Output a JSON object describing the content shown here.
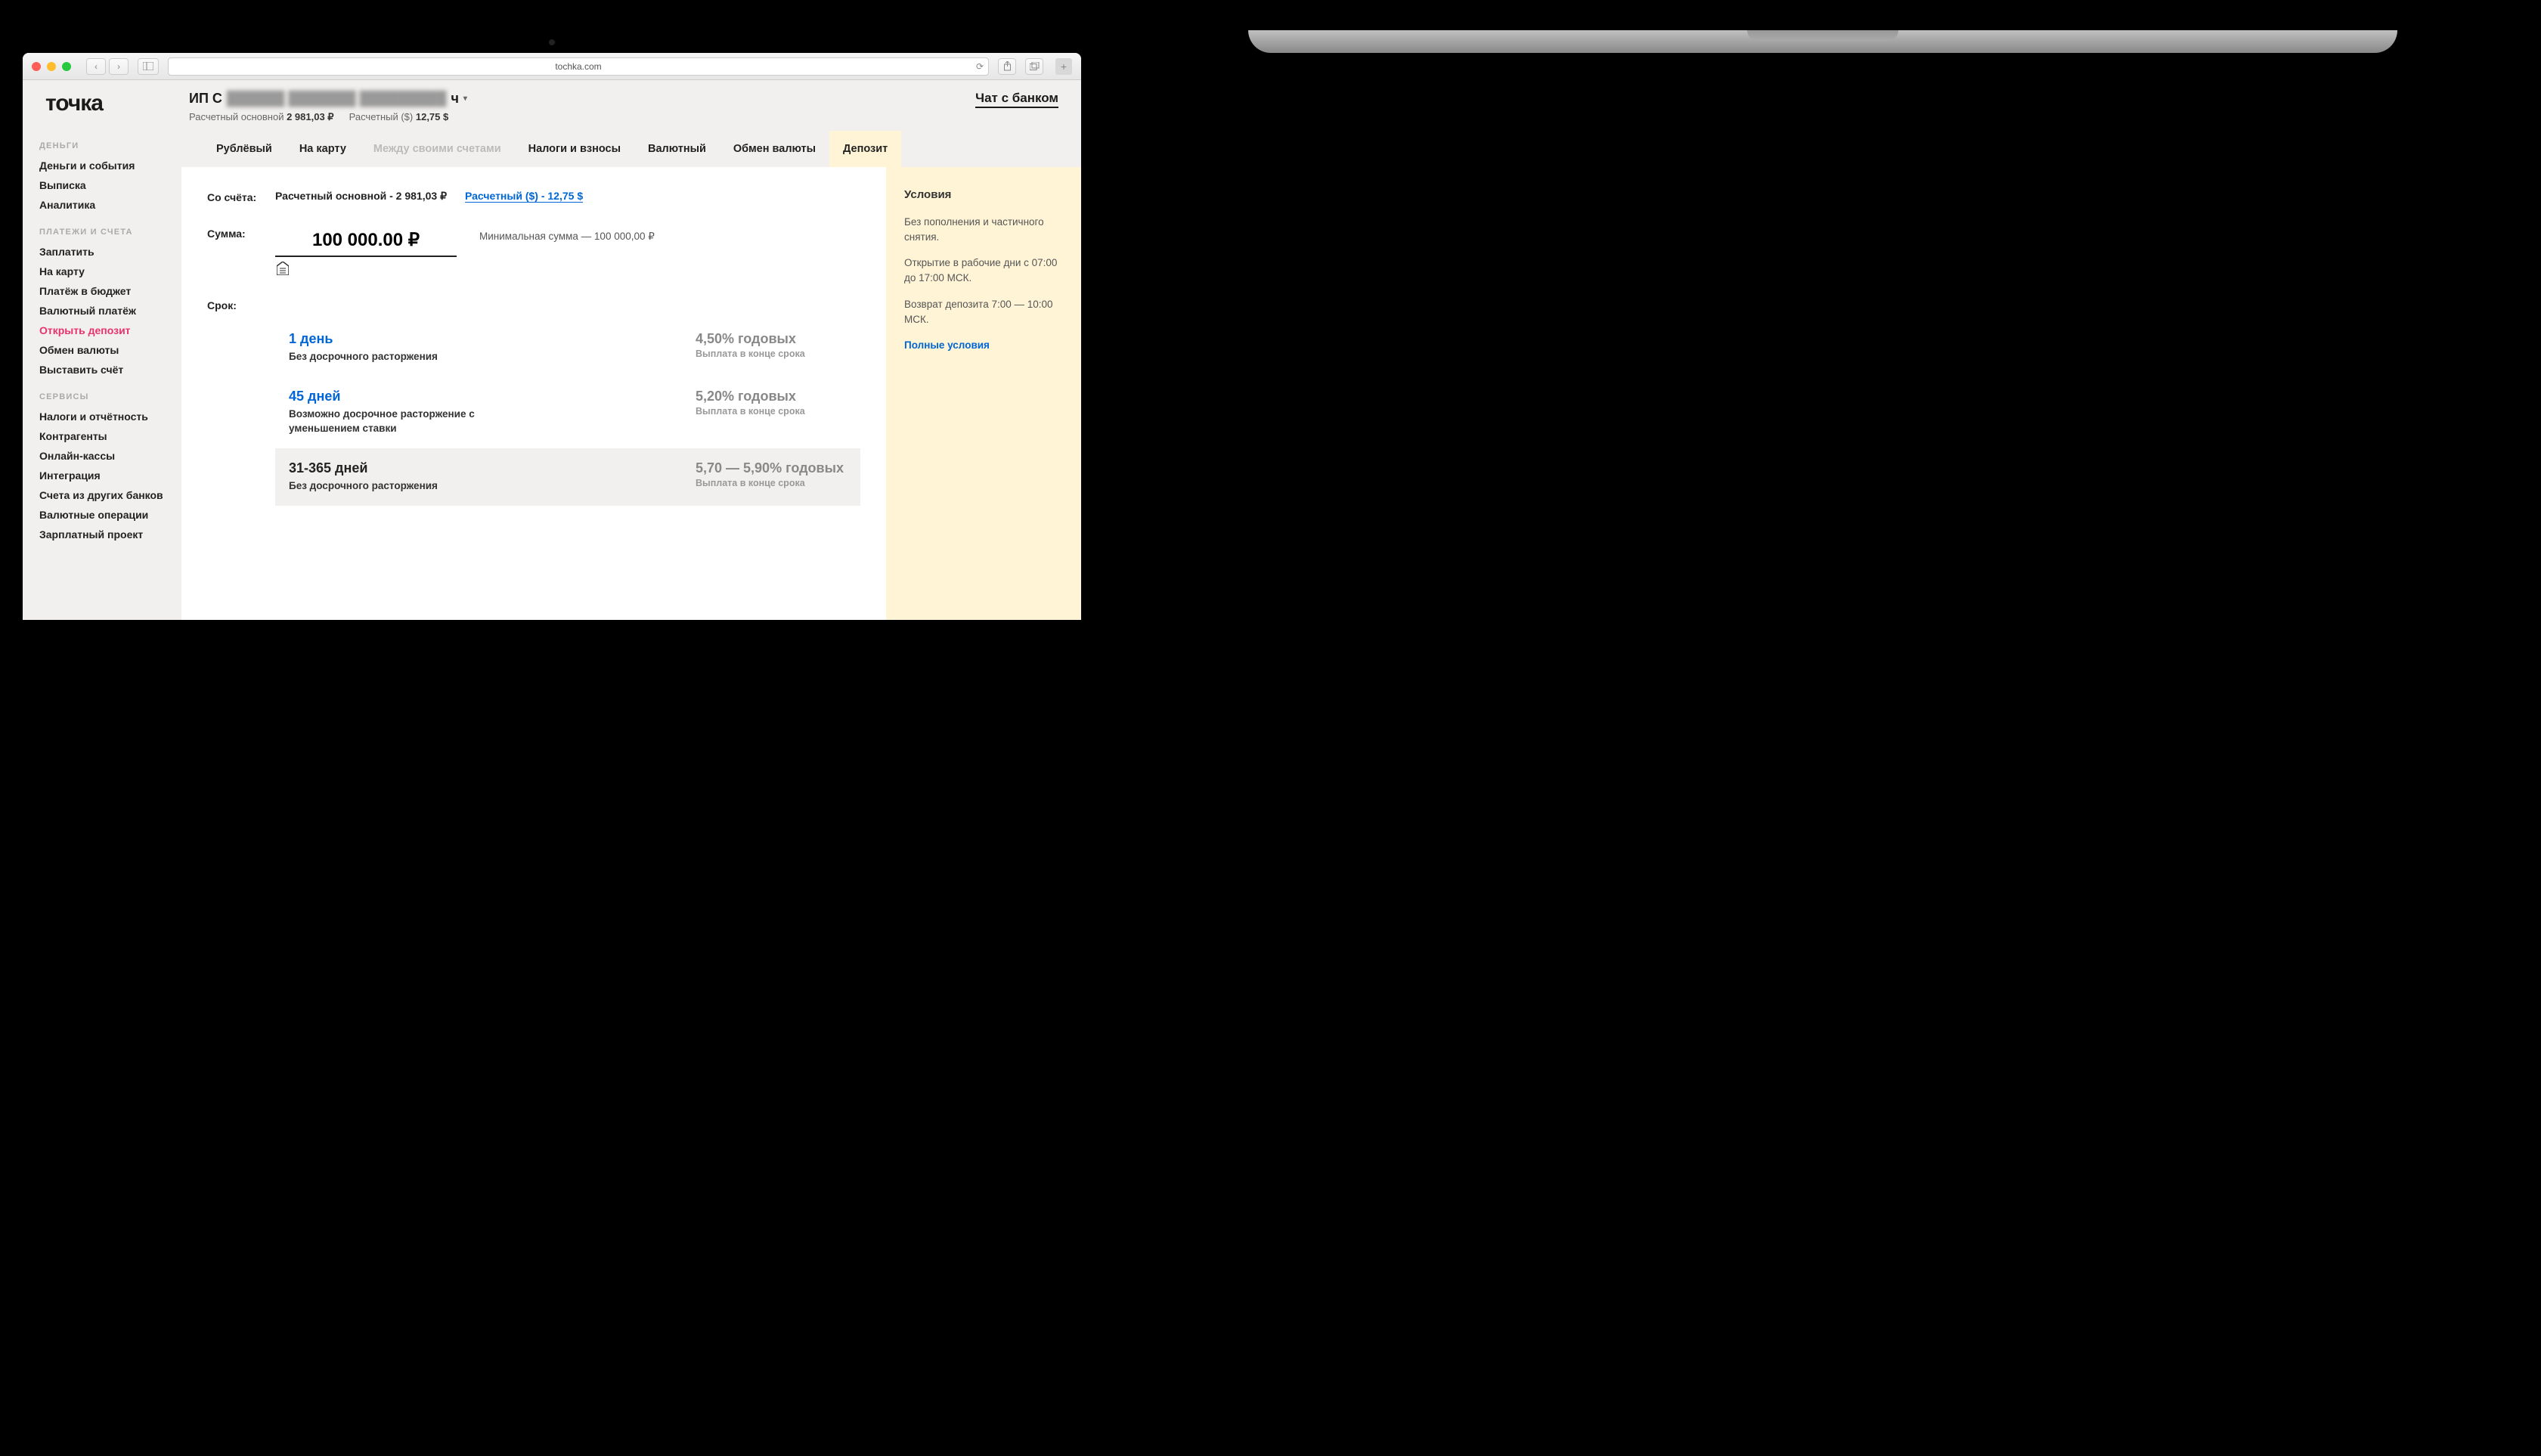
{
  "browser": {
    "url": "tochka.com"
  },
  "logo": "точка",
  "account_name_prefix": "ИП С",
  "account_name_blur": "██████ ███████ █████████",
  "account_name_suffix": "ч",
  "balances": {
    "rub_label": "Расчетный основной",
    "rub_value": "2 981,03 ₽",
    "usd_label": "Расчетный ($)",
    "usd_value": "12,75 $"
  },
  "chat_label": "Чат с банком",
  "sidebar": {
    "g1_head": "ДЕНЬГИ",
    "g1": [
      "Деньги и события",
      "Выписка",
      "Аналитика"
    ],
    "g2_head": "ПЛАТЕЖИ И СЧЕТА",
    "g2": [
      "Заплатить",
      "На карту",
      "Платёж в бюджет",
      "Валютный платёж",
      "Открыть депозит",
      "Обмен валюты",
      "Выставить счёт"
    ],
    "g3_head": "СЕРВИСЫ",
    "g3": [
      "Налоги и отчётность",
      "Контрагенты",
      "Онлайн-кассы",
      "Интеграция",
      "Счета из других банков",
      "Валютные операции",
      "Зарплатный проект"
    ]
  },
  "tabs": [
    "Рублёвый",
    "На карту",
    "Между своими счетами",
    "Налоги и взносы",
    "Валютный",
    "Обмен валюты",
    "Депозит"
  ],
  "form": {
    "from_label": "Со счёта:",
    "from_main": "Расчетный основной - 2 981,03 ₽",
    "from_usd": "Расчетный ($) - 12,75 $",
    "amount_label": "Сумма:",
    "amount_value": "100 000.00 ₽",
    "min_amount": "Минимальная сумма — 100 000,00 ₽",
    "term_label": "Срок:"
  },
  "terms": [
    {
      "title": "1 день",
      "sub": "Без досрочного расторжения",
      "rate": "4,50% годовых",
      "rate_sub": "Выплата в конце срока"
    },
    {
      "title": "45 дней",
      "sub": "Возможно досрочное расторжение с уменьшением ставки",
      "rate": "5,20% годовых",
      "rate_sub": "Выплата в конце срока"
    },
    {
      "title": "31-365 дней",
      "sub": "Без досрочного расторжения",
      "rate": "5,70 — 5,90% годовых",
      "rate_sub": "Выплата в конце срока"
    }
  ],
  "panel": {
    "head": "Условия",
    "p1": "Без пополнения и частичного снятия.",
    "p2": "Открытие в рабочие дни с 07:00 до 17:00 МСК.",
    "p3": "Возврат депозита 7:00 — 10:00 МСК.",
    "link": "Полные условия"
  }
}
